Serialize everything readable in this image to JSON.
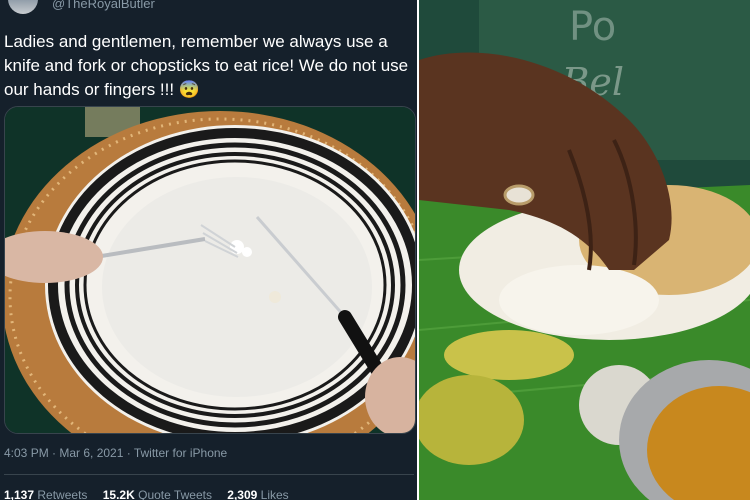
{
  "tweet": {
    "handle": "@TheRoyalButler",
    "text": "Ladies and gentlemen, remember we always use a knife and fork or chopsticks to eat rice! We do not use our hands or fingers !!! 😨",
    "meta": "4:03 PM · Mar 6, 2021 · Twitter for iPhone",
    "stats": [
      {
        "count": "1,137",
        "label": "Retweets"
      },
      {
        "count": "15.2K",
        "label": "Quote Tweets"
      },
      {
        "count": "2,309",
        "label": "Likes"
      }
    ]
  },
  "colors": {
    "tweet_bg": "#15202b",
    "tweet_text": "#ffffff",
    "muted": "#8899a6",
    "banana_leaf": "#3a8a2a"
  },
  "icons": [
    "avatar-image",
    "fearful-face-emoji"
  ]
}
